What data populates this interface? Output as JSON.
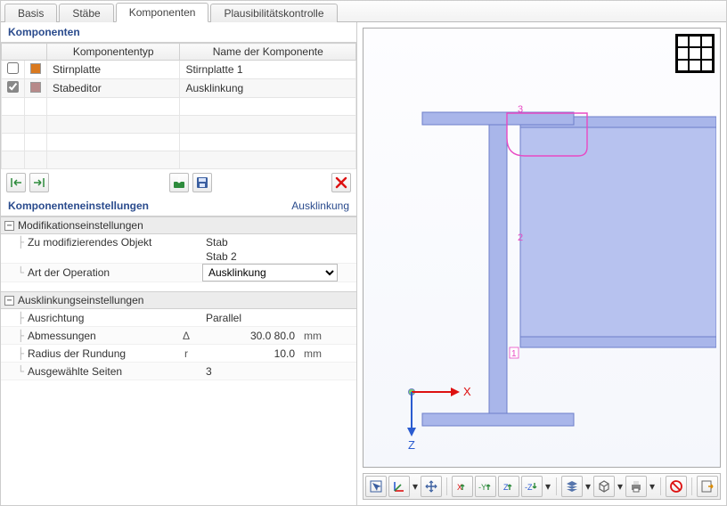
{
  "tabs": {
    "basis": "Basis",
    "staebe": "Stäbe",
    "komponenten": "Komponenten",
    "plausi": "Plausibilitätskontrolle"
  },
  "panels": {
    "komponenten_title": "Komponenten",
    "settings_title": "Komponenteneinstellungen",
    "settings_context": "Ausklinkung"
  },
  "table": {
    "col_type": "Komponententyp",
    "col_name": "Name der Komponente",
    "rows": [
      {
        "checked": false,
        "color": "#d9791f",
        "type": "Stirnplatte",
        "name": "Stirnplatte 1"
      },
      {
        "checked": true,
        "color": "#b78a8a",
        "type": "Stabeditor",
        "name": "Ausklinkung"
      }
    ]
  },
  "tree": {
    "sec1_title": "Modifikationseinstellungen",
    "row1_label": "Zu modifizierendes Objekt",
    "row1_val1": "Stab",
    "row1_val2": "Stab 2",
    "row2_label": "Art der Operation",
    "row2_val": "Ausklinkung",
    "sec2_title": "Ausklinkungseinstellungen",
    "row3_label": "Ausrichtung",
    "row3_val": "Parallel",
    "row4_label": "Abmessungen",
    "row4_sym": "Δ",
    "row4_val": "30.0 80.0",
    "row4_unit": "mm",
    "row5_label": "Radius der Rundung",
    "row5_sym": "r",
    "row5_val": "10.0",
    "row5_unit": "mm",
    "row6_label": "Ausgewählte Seiten",
    "row6_val": "3"
  },
  "viewport": {
    "axis_x": "X",
    "axis_z": "Z",
    "label_2": "2",
    "label_3": "3"
  },
  "colors": {
    "beam_fill": "#a9b6ea",
    "beam_stroke": "#6d7fc9",
    "highlight": "#e849c4"
  }
}
